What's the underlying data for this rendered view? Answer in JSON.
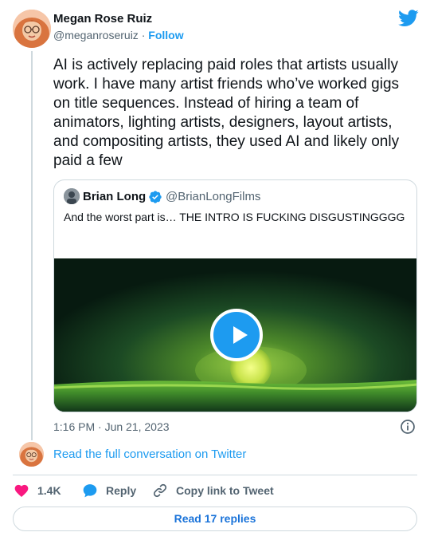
{
  "author": {
    "name": "Megan Rose Ruiz",
    "handle": "@meganroseruiz",
    "separator": "·",
    "follow_label": "Follow"
  },
  "tweet": {
    "text": "AI is actively replacing paid roles that artists usually work. I have many artist friends who’ve worked gigs on title sequences. Instead of hiring a team of animators, lighting artists, designers, layout artists, and compositing artists, they used AI and likely only paid a few"
  },
  "quote": {
    "name": "Brian Long",
    "handle": "@BrianLongFilms",
    "text": "And the worst part is… THE INTRO IS FUCKING DISGUSTINGGGG"
  },
  "meta": {
    "timestamp": "1:16 PM · Jun 21, 2023"
  },
  "conversation": {
    "label": "Read the full conversation on Twitter"
  },
  "actions": {
    "likes": "1.4K",
    "reply_label": "Reply",
    "copy_label": "Copy link to Tweet"
  },
  "replies": {
    "label": "Read 17 replies"
  },
  "icons": {
    "logo": "twitter-bird-icon",
    "verified": "verified-badge-icon",
    "play": "play-icon",
    "info": "info-icon",
    "like": "heart-icon",
    "reply": "speech-bubble-icon",
    "copy": "link-icon"
  },
  "colors": {
    "accent": "#1d9bf0",
    "text": "#0f1419",
    "muted": "#536471",
    "like": "#f91880",
    "border": "#cfd9de"
  }
}
